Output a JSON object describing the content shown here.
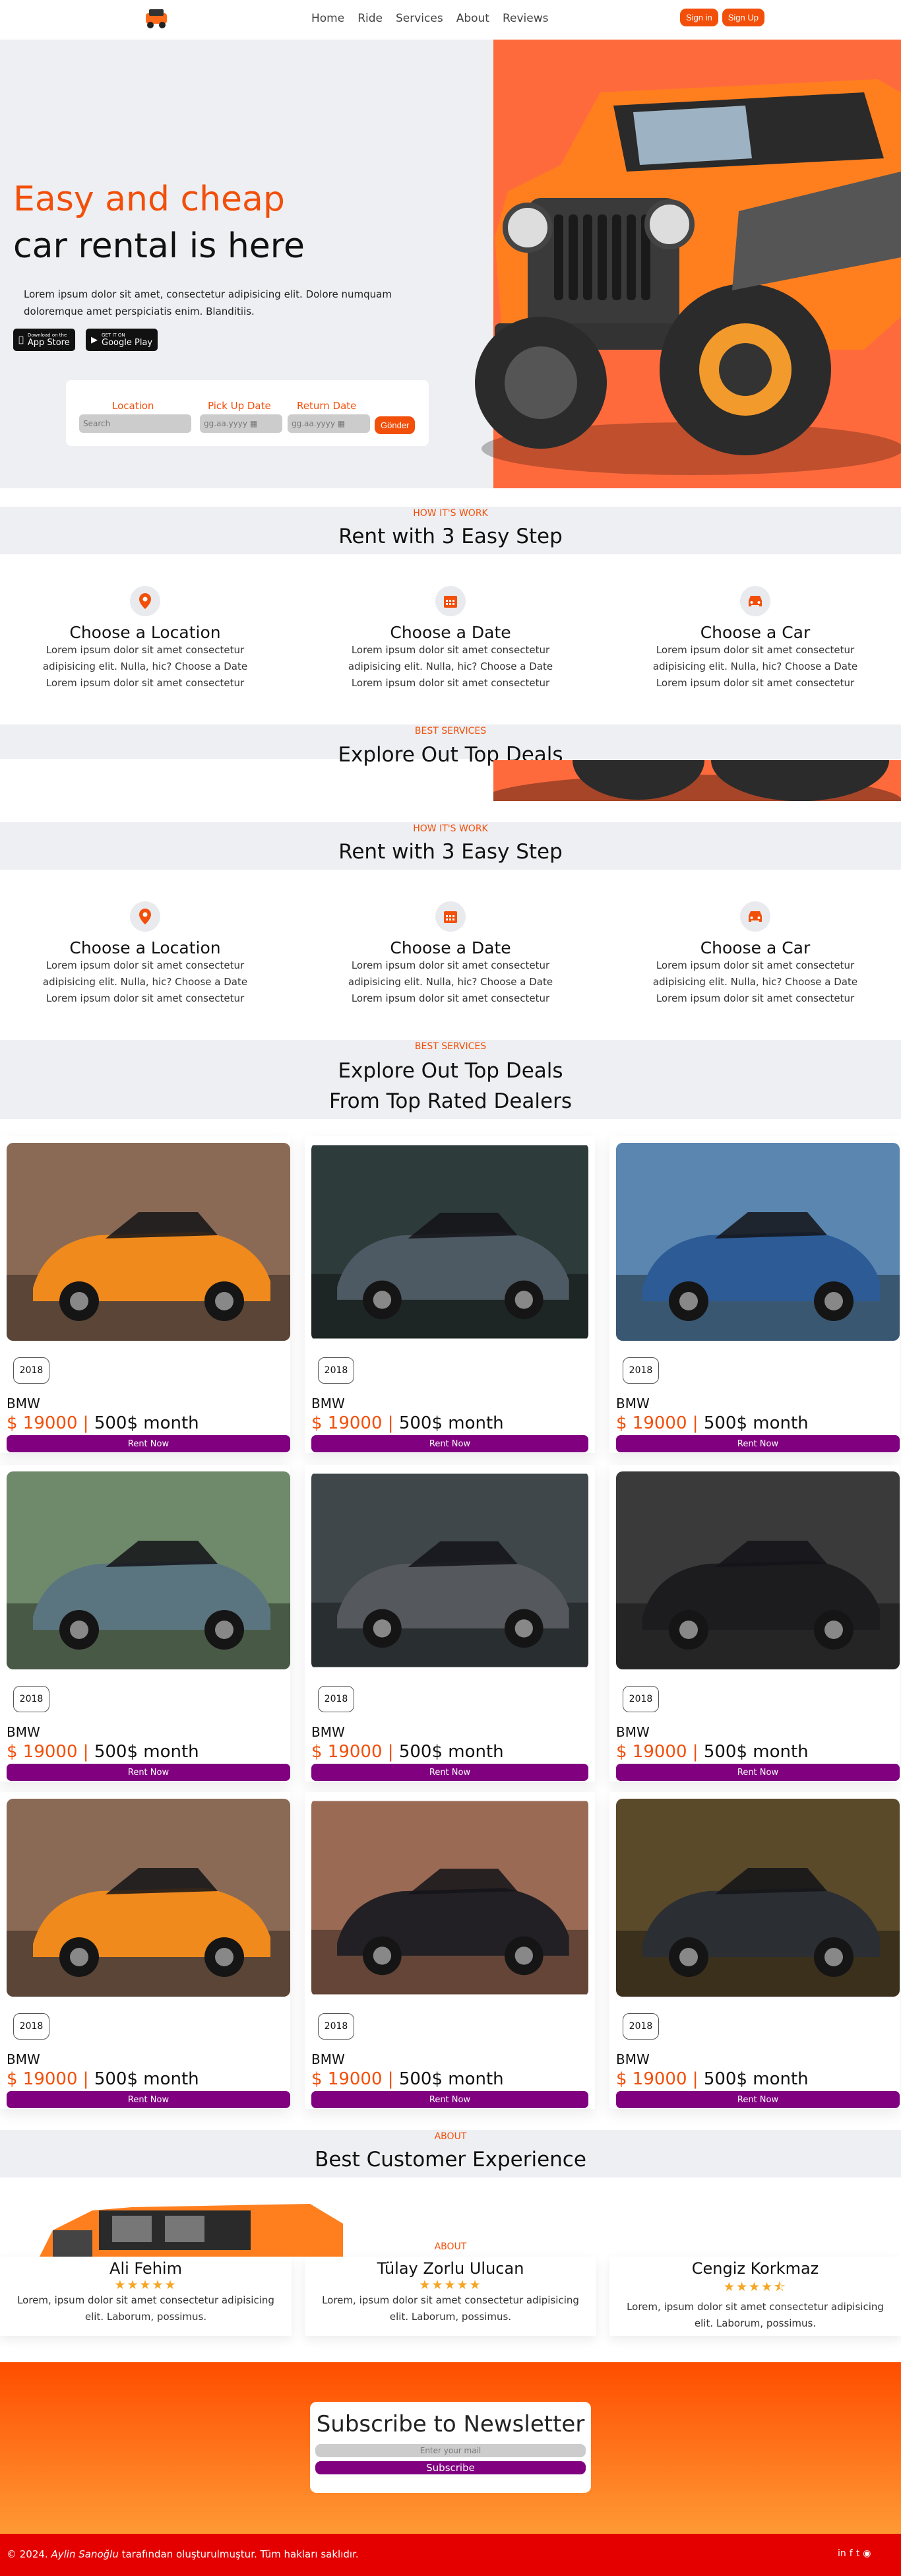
{
  "nav": {
    "links": [
      "Home",
      "Ride",
      "Services",
      "About",
      "Reviews"
    ],
    "signin": "Sign in",
    "signup": "Sign Up"
  },
  "hero": {
    "title_line1": "Easy and cheap",
    "title_line2": "car rental is here",
    "text": "Lorem ipsum dolor sit amet, consectetur adipisicing elit. Dolore numquam doloremque amet perspiciatis enim. Blanditiis.",
    "appstore_small": "Download on the",
    "appstore": "App Store",
    "googleplay_small": "GET IT ON",
    "googleplay": "Google Play"
  },
  "booking": {
    "location_label": "Location",
    "pickup_label": "Pick Up Date",
    "return_label": "Return Date",
    "search_placeholder": "Search",
    "date_placeholder": "gg.aa.yyyy",
    "send": "Gönder"
  },
  "how": {
    "eyebrow": "HOW IT'S WORK",
    "title": "Rent with 3 Easy Step",
    "steps": [
      {
        "title": "Choose a Location",
        "text": "Lorem ipsum dolor sit amet consectetur adipisicing elit. Nulla, hic? Choose a Date Lorem ipsum dolor sit amet consectetur"
      },
      {
        "title": "Choose a Date",
        "text": "Lorem ipsum dolor sit amet consectetur adipisicing elit. Nulla, hic? Choose a Date Lorem ipsum dolor sit amet consectetur"
      },
      {
        "title": "Choose a Car",
        "text": "Lorem ipsum dolor sit amet consectetur adipisicing elit. Nulla, hic? Choose a Date Lorem ipsum dolor sit amet consectetur"
      }
    ]
  },
  "deals": {
    "eyebrow": "BEST SERVICES",
    "title_partial": "Explore Out Top Deals",
    "title_line1": "Explore Out Top Deals",
    "title_line2": "From Top Rated Dealers",
    "cards": [
      {
        "year": "2018",
        "brand": "BMW",
        "price": "$ 19000",
        "month": "500$ month",
        "rent": "Rent Now",
        "color": "#f08a1c",
        "bg": "#8a6a55"
      },
      {
        "year": "2018",
        "brand": "BMW",
        "price": "$ 19000",
        "month": "500$ month",
        "rent": "Rent Now",
        "color": "#4d5a63",
        "bg": "#2d3b3a"
      },
      {
        "year": "2018",
        "brand": "BMW",
        "price": "$ 19000",
        "month": "500$ month",
        "rent": "Rent Now",
        "color": "#2c5b95",
        "bg": "#5a86b0"
      },
      {
        "year": "2018",
        "brand": "BMW",
        "price": "$ 19000",
        "month": "500$ month",
        "rent": "Rent Now",
        "color": "#5a7580",
        "bg": "#6f8a6a"
      },
      {
        "year": "2018",
        "brand": "BMW",
        "price": "$ 19000",
        "month": "500$ month",
        "rent": "Rent Now",
        "color": "#55585c",
        "bg": "#3f474a"
      },
      {
        "year": "2018",
        "brand": "BMW",
        "price": "$ 19000",
        "month": "500$ month",
        "rent": "Rent Now",
        "color": "#1c1c1e",
        "bg": "#3a3a3a"
      },
      {
        "year": "2018",
        "brand": "BMW",
        "price": "$ 19000",
        "month": "500$ month",
        "rent": "Rent Now",
        "color": "#f08a1c",
        "bg": "#8a6a55"
      },
      {
        "year": "2018",
        "brand": "BMW",
        "price": "$ 19000",
        "month": "500$ month",
        "rent": "Rent Now",
        "color": "#222024",
        "bg": "#9a6a55"
      },
      {
        "year": "2018",
        "brand": "BMW",
        "price": "$ 19000",
        "month": "500$ month",
        "rent": "Rent Now",
        "color": "#2b2e33",
        "bg": "#5a4a2a"
      }
    ]
  },
  "about": {
    "eyebrow": "ABOUT",
    "title": "Best Customer Experience",
    "eyebrow2": "ABOUT"
  },
  "testimonials": [
    {
      "name": "Ali Fehim",
      "stars": "★★★★★",
      "text": "Lorem, ipsum dolor sit amet consectetur adipisicing elit. Laborum, possimus."
    },
    {
      "name": "Tülay Zorlu Ulucan",
      "stars": "★★★★★",
      "text": "Lorem, ipsum dolor sit amet consectetur adipisicing elit. Laborum, possimus."
    },
    {
      "name": "Cengiz Korkmaz",
      "stars": "★★★★⯪",
      "text": "Lorem, ipsum dolor sit amet consectetur adipisicing elit. Laborum, possimus."
    }
  ],
  "newsletter": {
    "title": "Subscribe to Newsletter",
    "placeholder": "Enter your mail",
    "button": "Subscribe"
  },
  "footer": {
    "prefix": "© 2024. ",
    "author": "Aylin Sanoğlu",
    "suffix": " tarafından oluşturulmuştur. Tüm hakları saklıdır.",
    "icons": [
      "in",
      "f",
      "t",
      "◉"
    ]
  },
  "colors": {
    "accent": "#f24f0a",
    "purple": "#800080",
    "hero_orange": "#ff6a3d",
    "footer_red": "#e50000"
  }
}
